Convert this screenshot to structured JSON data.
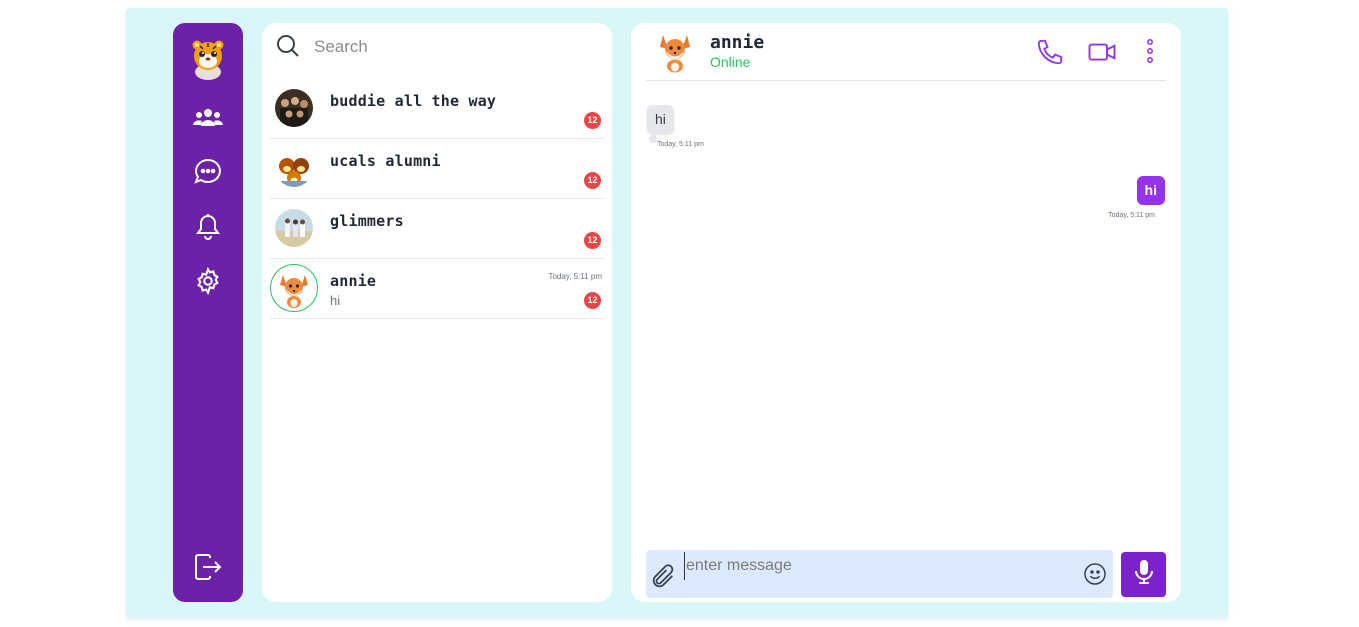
{
  "sidebar": {
    "logo": "tiger-avatar-icon",
    "nav": [
      "groups-icon",
      "chat-bubble-icon",
      "bell-icon",
      "gear-icon"
    ],
    "logout": "logout-icon",
    "color": "#6b21a8"
  },
  "search": {
    "placeholder": "Search"
  },
  "chats": [
    {
      "name": "buddie all the way",
      "badge": "12",
      "time": "",
      "preview": ""
    },
    {
      "name": "ucals alumni",
      "badge": "12",
      "time": "",
      "preview": ""
    },
    {
      "name": "glimmers",
      "badge": "12",
      "time": "",
      "preview": ""
    },
    {
      "name": "annie",
      "badge": "12",
      "time": "Today, 5:11 pm",
      "preview": "hi"
    }
  ],
  "conversation": {
    "name": "annie",
    "status": "Online",
    "messages": [
      {
        "direction": "in",
        "text": "hi",
        "time": "Today, 5:11 pm"
      },
      {
        "direction": "out",
        "text": "hi",
        "time": "Today, 5:11 pm"
      }
    ],
    "composer_placeholder": "enter message"
  },
  "colors": {
    "accent": "#9333ea",
    "online": "#22c55e",
    "badge": "#ef4444",
    "background": "#d9f6f9"
  }
}
